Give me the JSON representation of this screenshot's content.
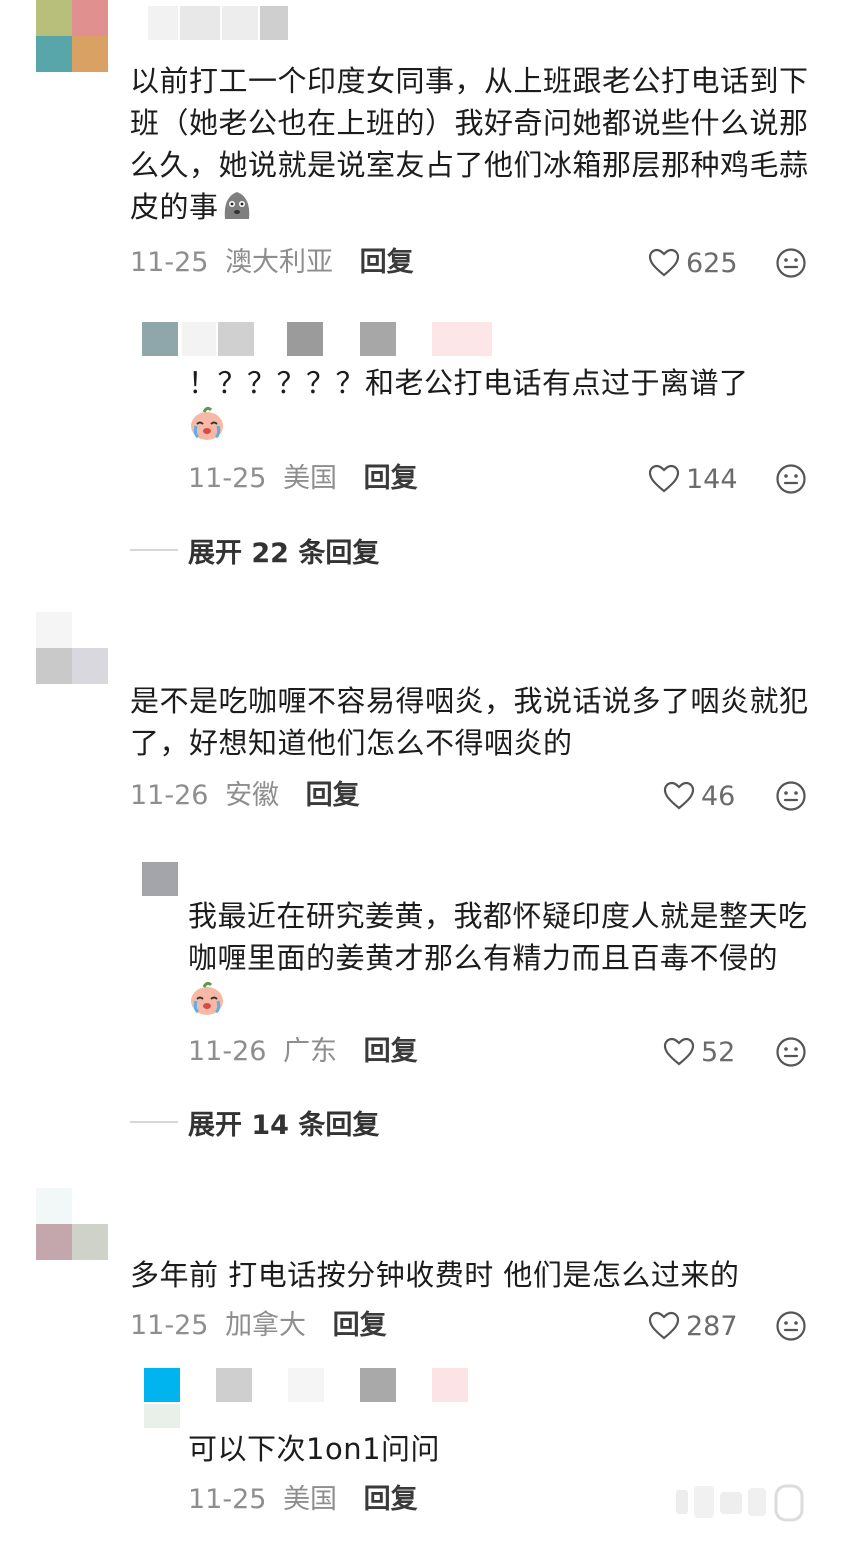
{
  "comments": [
    {
      "text": "以前打工一个印度女同事，从上班跟老公打电话到下班（她老公也在上班的）我好奇问她都说些什么说那么久，她说就是说室友占了他们冰箱那层那种鸡毛蒜皮的事",
      "date": "11-25",
      "location": "澳大利亚",
      "reply_label": "回复",
      "likes": "625",
      "replies": [
        {
          "text": "！？？？？？和老公打电话有点过于离谱了",
          "date": "11-25",
          "location": "美国",
          "reply_label": "回复",
          "likes": "144"
        }
      ],
      "expand_label": "展开 22 条回复"
    },
    {
      "text": "是不是吃咖喱不容易得咽炎，我说话说多了咽炎就犯了，好想知道他们怎么不得咽炎的",
      "date": "11-26",
      "location": "安徽",
      "reply_label": "回复",
      "likes": "46",
      "replies": [
        {
          "text": "我最近在研究姜黄，我都怀疑印度人就是整天吃咖喱里面的姜黄才那么有精力而且百毒不侵的",
          "date": "11-26",
          "location": "广东",
          "reply_label": "回复",
          "likes": "52"
        }
      ],
      "expand_label": "展开 14 条回复"
    },
    {
      "text": "多年前 打电话按分钟收费时 他们是怎么过来的",
      "date": "11-25",
      "location": "加拿大",
      "reply_label": "回复",
      "likes": "287",
      "replies": [
        {
          "text": "可以下次1on1问问",
          "date": "11-25",
          "location": "美国",
          "reply_label": "回复"
        }
      ]
    }
  ],
  "icons": {
    "like": "heart-outline-icon",
    "emoji": "smiley-face-icon",
    "watermark": "logo-watermark"
  },
  "colors": {
    "text": "#1c1c1c",
    "meta": "#8e8e8e",
    "reply": "#3a3a3a"
  }
}
